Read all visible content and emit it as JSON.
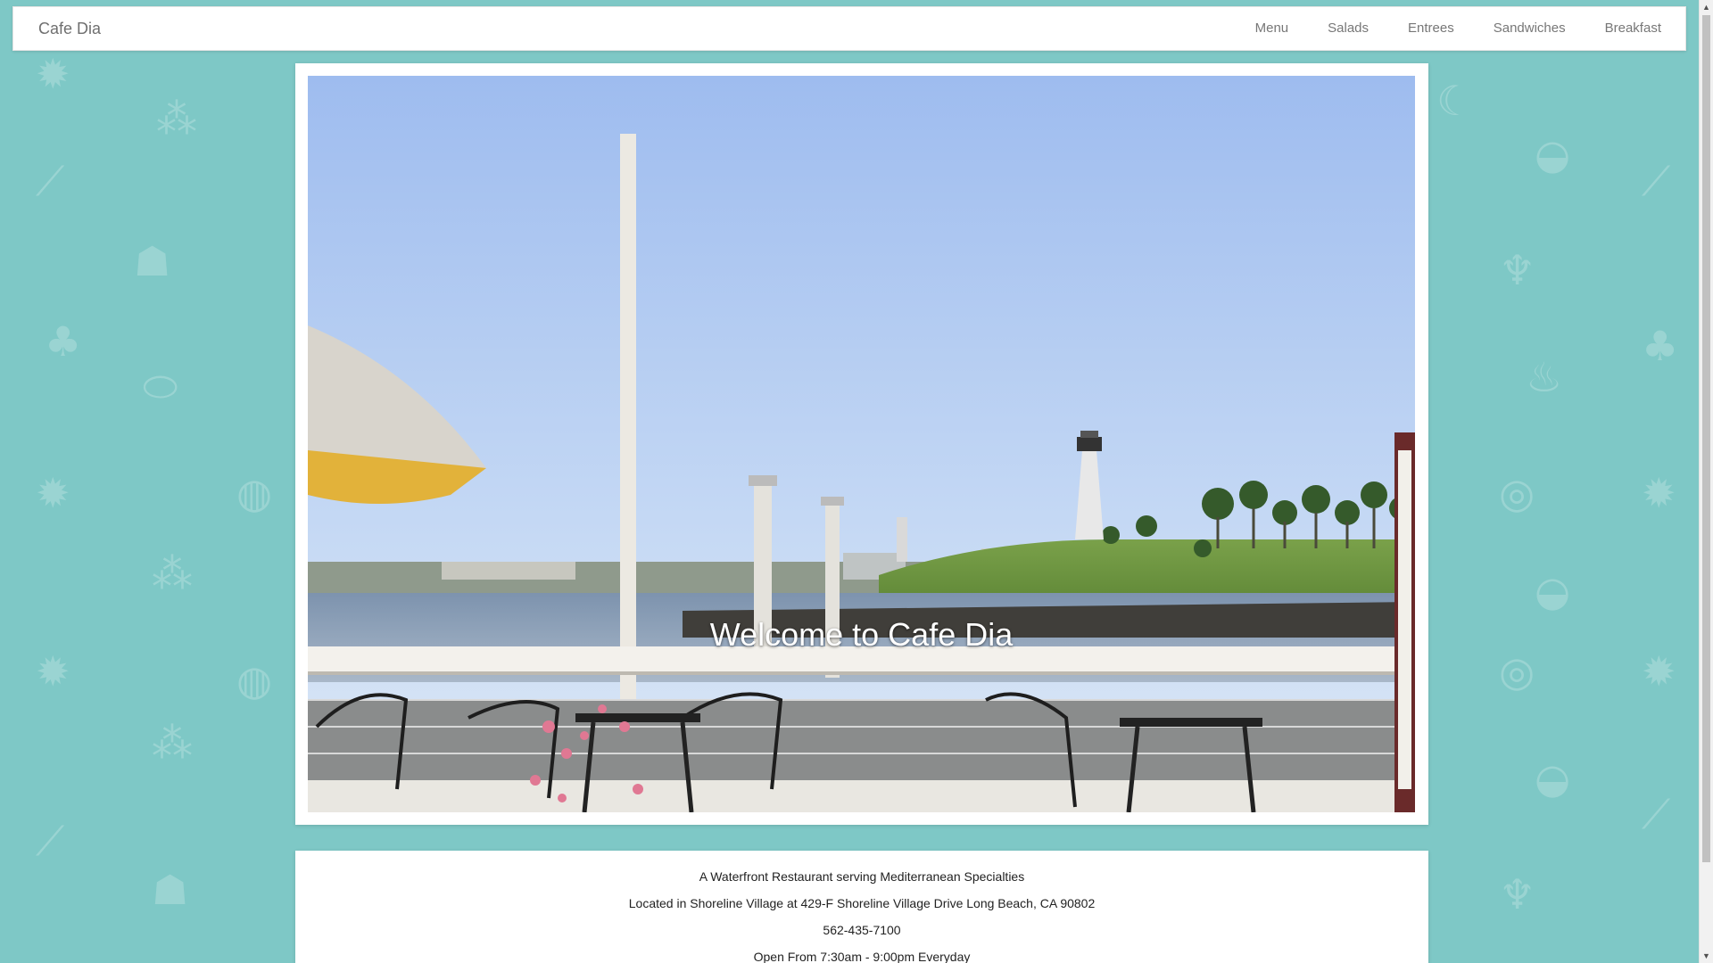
{
  "navbar": {
    "brand": "Cafe Dia",
    "items": [
      {
        "label": "Menu"
      },
      {
        "label": "Salads"
      },
      {
        "label": "Entrees"
      },
      {
        "label": "Sandwiches"
      },
      {
        "label": "Breakfast"
      }
    ]
  },
  "hero": {
    "caption": "Welcome to Cafe Dia",
    "image_description_icon": "waterfront-patio-photo"
  },
  "info": {
    "tagline": "A Waterfront Restaurant serving Mediterranean Specialties",
    "location": "Located in Shoreline Village at 429-F Shoreline Village Drive Long Beach, CA 90802",
    "phone": "562-435-7100",
    "hours": "Open From 7:30am - 9:00pm Everyday"
  },
  "colors": {
    "background": "#7ec8c6",
    "navbar": "#ffffff",
    "nav_text": "#777777",
    "brand_text": "#6f6f6f"
  },
  "scrollbar": {
    "up_icon": "scroll-up-arrow-icon",
    "down_icon": "scroll-down-arrow-icon"
  }
}
